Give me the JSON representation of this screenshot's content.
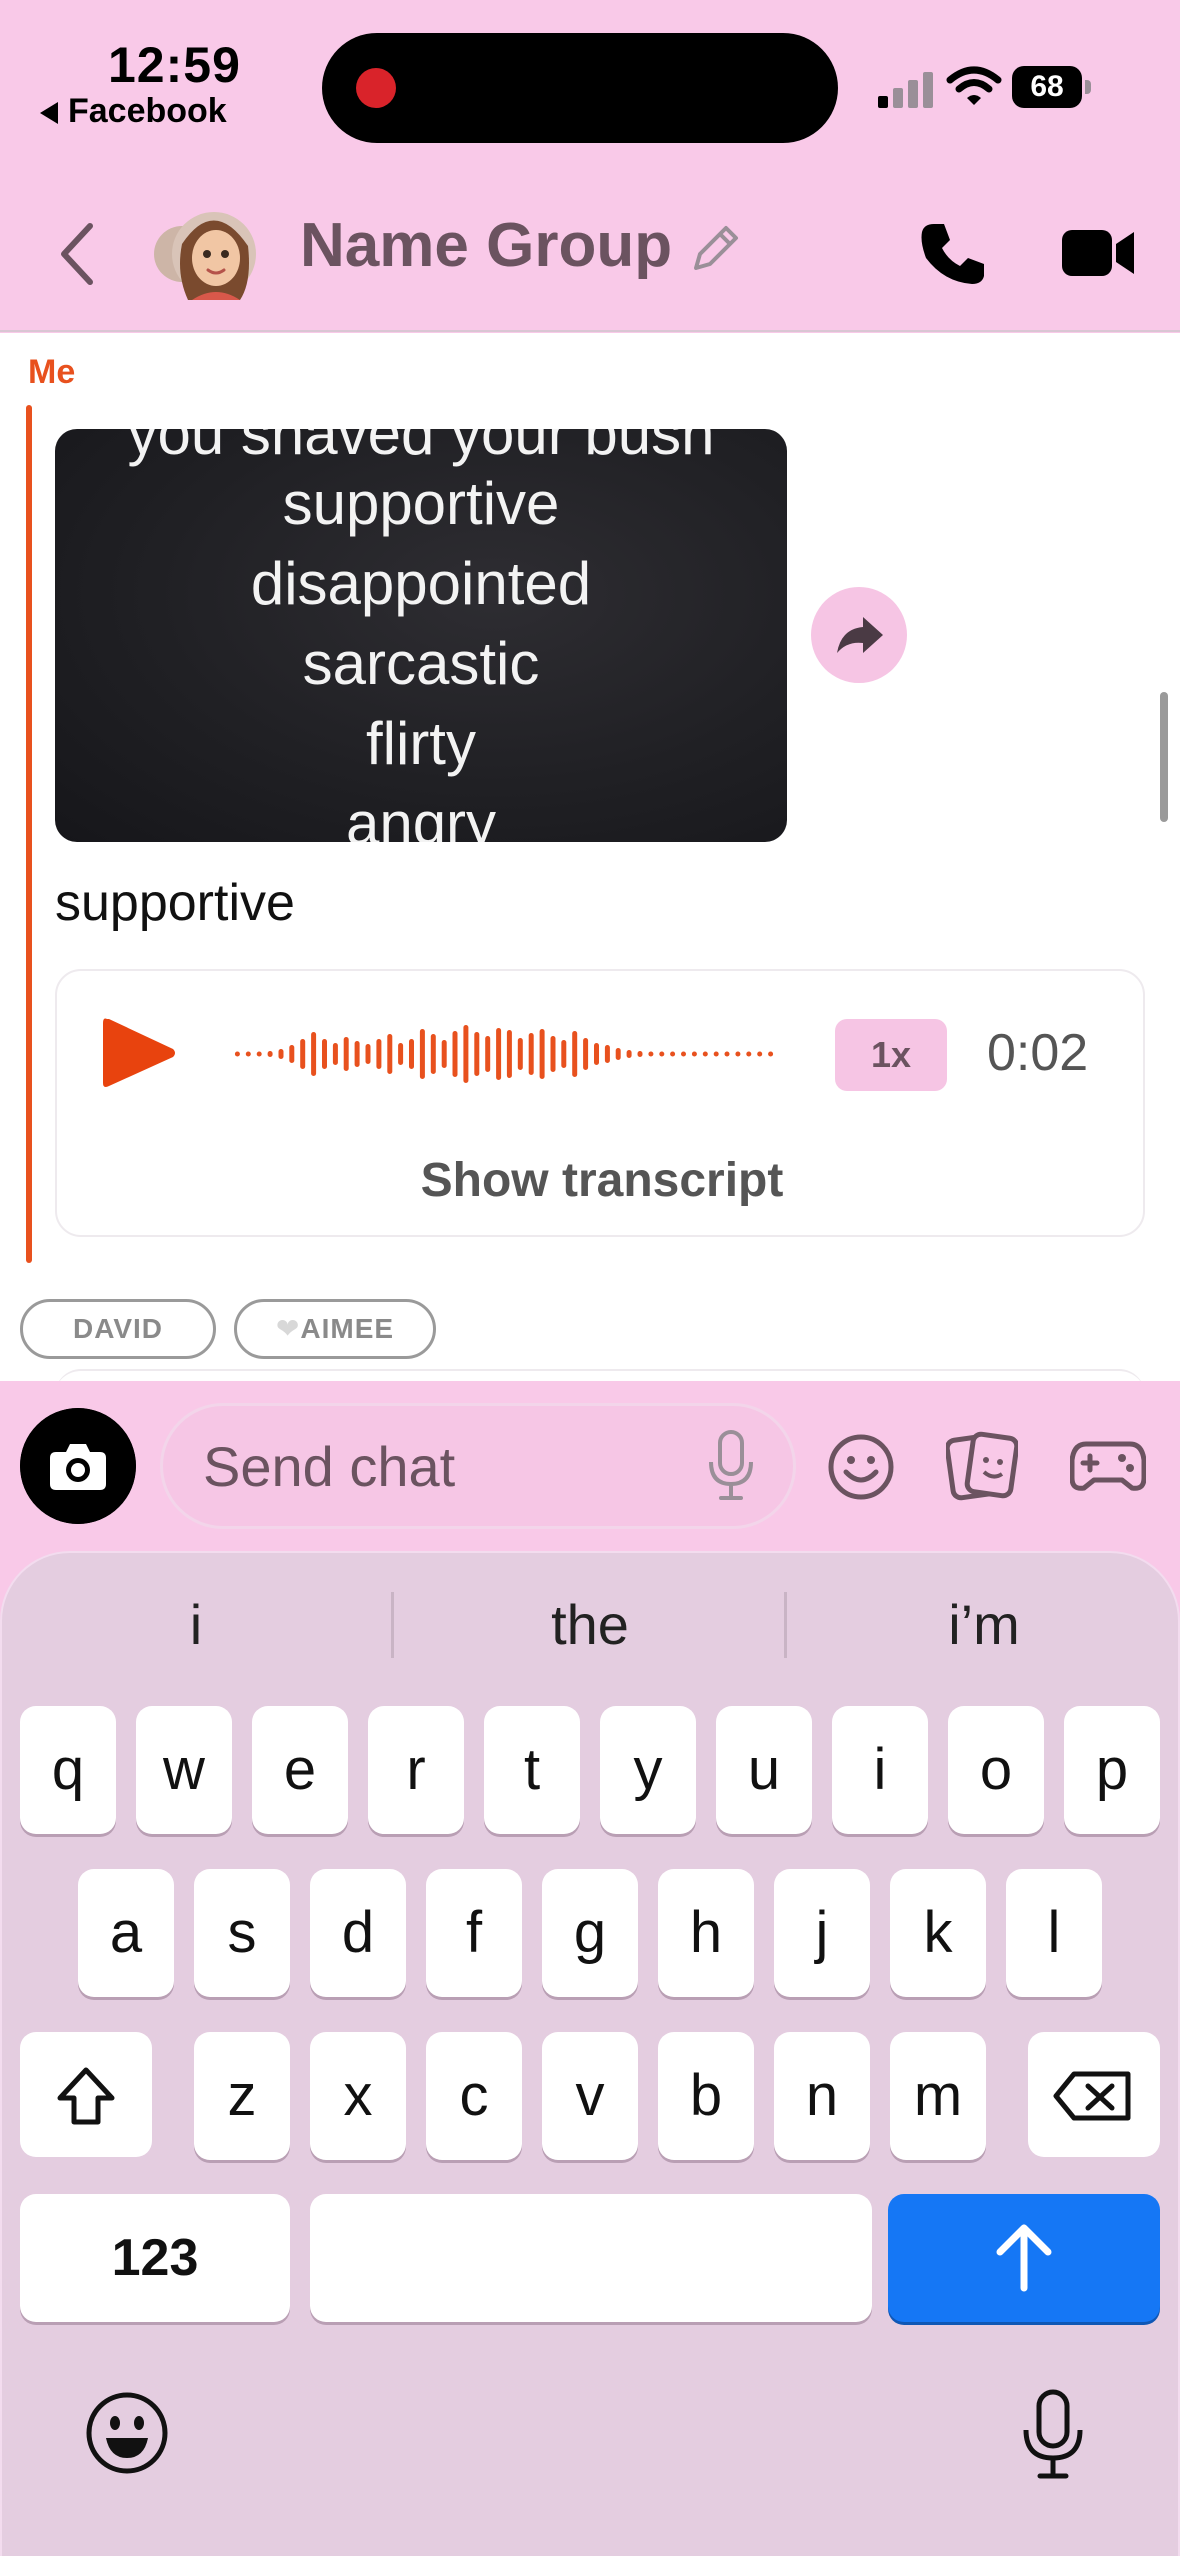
{
  "status_bar": {
    "time": "12:59",
    "back_app": "Facebook",
    "battery": "68"
  },
  "header": {
    "title": "Name Group"
  },
  "chat": {
    "sender": "Me",
    "media_lines": [
      "you shaved your bush",
      "supportive",
      "disappointed",
      "sarcastic",
      "flirty",
      "angry"
    ],
    "caption": "supportive",
    "voice": {
      "speed": "1x",
      "duration": "0:02",
      "transcript_label": "Show transcript"
    },
    "reactions": [
      "DAVID",
      "AIMEE"
    ],
    "reaction_icons": [
      "heart-icon"
    ]
  },
  "input": {
    "placeholder": "Send chat"
  },
  "keyboard": {
    "suggestions": [
      "i",
      "the",
      "i’m"
    ],
    "row1": [
      "q",
      "w",
      "e",
      "r",
      "t",
      "y",
      "u",
      "i",
      "o",
      "p"
    ],
    "row2": [
      "a",
      "s",
      "d",
      "f",
      "g",
      "h",
      "j",
      "k",
      "l"
    ],
    "row3": [
      "z",
      "x",
      "c",
      "v",
      "b",
      "n",
      "m"
    ],
    "numbers_label": "123"
  },
  "colors": {
    "accent": "#e8511e",
    "pink": "#f9c9e8",
    "send_blue": "#1577f5"
  }
}
